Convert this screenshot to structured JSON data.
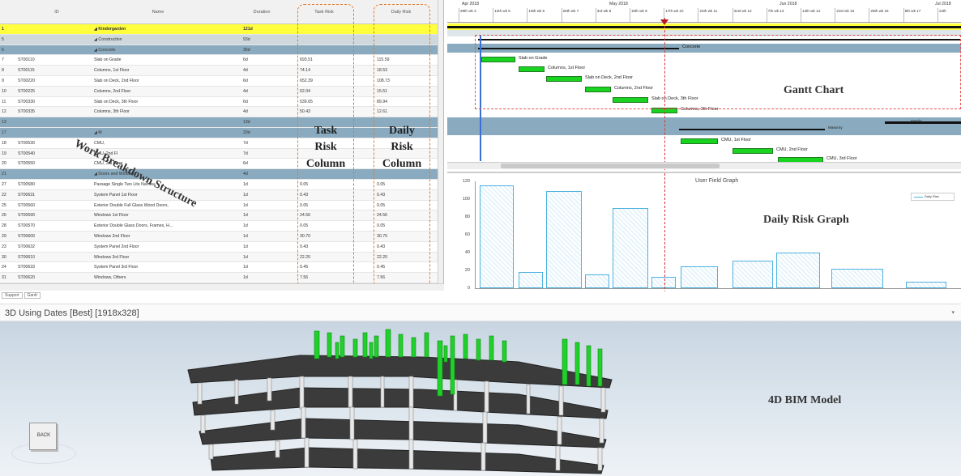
{
  "grid": {
    "headers": {
      "id": "ID",
      "name": "Name",
      "duration": "Duration",
      "task_risk": "Task Risk",
      "daily_risk": "Daily Risk"
    },
    "rows": [
      {
        "num": "1",
        "id": "",
        "name": "◢ Kindergarden",
        "duration": "121d",
        "task_risk": "",
        "daily_risk": "",
        "level": "lvl0"
      },
      {
        "num": "5",
        "id": "",
        "name": "◢ Construction",
        "duration": "93d",
        "task_risk": "",
        "daily_risk": "",
        "level": "lvl1"
      },
      {
        "num": "6",
        "id": "",
        "name": "◢ Concrete",
        "duration": "36d",
        "task_risk": "",
        "daily_risk": "",
        "level": "lvl2"
      },
      {
        "num": "7",
        "id": "ST00110",
        "name": "Slab on Grade",
        "duration": "6d",
        "task_risk": "693.51",
        "daily_risk": "115.59",
        "level": ""
      },
      {
        "num": "8",
        "id": "ST00115",
        "name": "Columns, 1st Floor",
        "duration": "4d",
        "task_risk": "74.14",
        "daily_risk": "18.53",
        "level": "alt"
      },
      {
        "num": "9",
        "id": "ST00220",
        "name": "Slab on Deck, 2nd Floor",
        "duration": "6d",
        "task_risk": "652.39",
        "daily_risk": "108.73",
        "level": ""
      },
      {
        "num": "10",
        "id": "ST00225",
        "name": "Columns, 2nd Floor",
        "duration": "4d",
        "task_risk": "62.04",
        "daily_risk": "15.51",
        "level": "alt"
      },
      {
        "num": "11",
        "id": "ST00330",
        "name": "Slab on Deck, 3th Floor",
        "duration": "6d",
        "task_risk": "539.65",
        "daily_risk": "89.94",
        "level": ""
      },
      {
        "num": "12",
        "id": "ST00335",
        "name": "Columns, 3th Floor",
        "duration": "4d",
        "task_risk": "50.43",
        "daily_risk": "12.61",
        "level": "alt"
      },
      {
        "num": "13",
        "id": "",
        "name": "",
        "duration": "13d",
        "task_risk": "",
        "daily_risk": "",
        "level": "lvl2"
      },
      {
        "num": "17",
        "id": "",
        "name": "◢ M",
        "duration": "20d",
        "task_risk": "",
        "daily_risk": "",
        "level": "lvl2"
      },
      {
        "num": "18",
        "id": "ST00530",
        "name": "CMU, ",
        "duration": "7d",
        "task_risk": "",
        "daily_risk": "",
        "level": ""
      },
      {
        "num": "19",
        "id": "ST00540",
        "name": "CMU, 2nd Fl",
        "duration": "7d",
        "task_risk": "",
        "daily_risk": "",
        "level": "alt"
      },
      {
        "num": "20",
        "id": "ST00550",
        "name": "CMU, 3rd Floor",
        "duration": "6d",
        "task_risk": "",
        "daily_risk": "",
        "level": ""
      },
      {
        "num": "21",
        "id": "",
        "name": "◢ Doors and Windows",
        "duration": "4d",
        "task_risk": "",
        "daily_risk": "",
        "level": "lvl2"
      },
      {
        "num": "27",
        "id": "ST00580",
        "name": "Passage Single Two Lite Narrow",
        "duration": "1d",
        "task_risk": "0.05",
        "daily_risk": "0.05",
        "level": ""
      },
      {
        "num": "22",
        "id": "ST00631",
        "name": "System Panel 1st Floor",
        "duration": "1d",
        "task_risk": "0.43",
        "daily_risk": "0.43",
        "level": "alt"
      },
      {
        "num": "25",
        "id": "ST00560",
        "name": "Exterior Double Full Glass Wood Doors,",
        "duration": "1d",
        "task_risk": "0.05",
        "daily_risk": "0.05",
        "level": ""
      },
      {
        "num": "26",
        "id": "ST00590",
        "name": "Windows 1st Floor",
        "duration": "1d",
        "task_risk": "24.56",
        "daily_risk": "24.56",
        "level": "alt"
      },
      {
        "num": "28",
        "id": "ST00570",
        "name": "Exterior Double Glass Doors, Frames, H...",
        "duration": "1d",
        "task_risk": "0.05",
        "daily_risk": "0.05",
        "level": ""
      },
      {
        "num": "29",
        "id": "ST00600",
        "name": "Windows 2nd Floor",
        "duration": "1d",
        "task_risk": "30.70",
        "daily_risk": "30.70",
        "level": "alt"
      },
      {
        "num": "23",
        "id": "ST00632",
        "name": "System Panel 2nd Floor",
        "duration": "1d",
        "task_risk": "0.43",
        "daily_risk": "0.43",
        "level": ""
      },
      {
        "num": "30",
        "id": "ST00610",
        "name": "Windows 3rd Floor",
        "duration": "1d",
        "task_risk": "22.20",
        "daily_risk": "22.20",
        "level": "alt"
      },
      {
        "num": "24",
        "id": "ST00633",
        "name": "System Panel 3rd Floor",
        "duration": "1d",
        "task_risk": "0.45",
        "daily_risk": "0.45",
        "level": ""
      },
      {
        "num": "31",
        "id": "ST00620",
        "name": "Windows, Others",
        "duration": "1d",
        "task_risk": "7.56",
        "daily_risk": "7.56",
        "level": "alt"
      }
    ],
    "tabs": [
      "Support",
      "Gantt"
    ]
  },
  "overlays": {
    "wbs": "Work Breakdown Structure",
    "task_risk_col": [
      "Task",
      "Risk",
      "Column"
    ],
    "daily_risk_col": [
      "Daily",
      "Risk",
      "Column"
    ],
    "gantt_label": "Gantt Chart",
    "daily_risk_graph": "Daily Risk Graph",
    "bim_label": "4D BIM Model"
  },
  "gantt": {
    "months": [
      "Apr 2018",
      "May 2018",
      "Jun 2018",
      "Jul 2018"
    ],
    "weeks": [
      "29th wk 4",
      "12th wk 5",
      "19th wk 6",
      "26th wk 7",
      "3rd wk 8",
      "10th wk 9",
      "17th wk 10",
      "24th wk 11",
      "31st wk 12",
      "7th wk 13",
      "14th wk 14",
      "21st wk 15",
      "28th wk 16",
      "5th wk 17",
      "12th"
    ],
    "task_labels": [
      "Slab on Grade",
      "Columns, 1st Floor",
      "Slab on Deck, 2nd Floor",
      "Columns, 2nd Floor",
      "Slab on Deck, 3th Floor",
      "Columns, 3th Floor",
      "CMU, 1st Floor",
      "CMU, 2nd Floor",
      "CMU, 3rd Floor"
    ],
    "summary_labels": [
      "Concrete",
      "Masonry",
      "Metals"
    ]
  },
  "risk_graph": {
    "title": "User Field Graph",
    "legend": "Daily Risk",
    "y_ticks": [
      "120",
      "100",
      "80",
      "60",
      "40",
      "20",
      "0"
    ]
  },
  "chart_data": {
    "type": "bar",
    "title": "User Field Graph",
    "ylim": [
      0,
      120
    ],
    "series": [
      {
        "name": "Daily Risk",
        "values": [
          115.59,
          18.53,
          108.73,
          15.51,
          89.94,
          12.61,
          24.56,
          30.7,
          40,
          22.2,
          7.56
        ]
      }
    ]
  },
  "bim": {
    "title": "3D Using Dates [Best] [1918x328]",
    "cube_label": "BACK",
    "chevron": "▾"
  },
  "colors": {
    "summary_bar": "#ffff3d",
    "task_bar": "#18d420",
    "risk_bar": "#4fb2e0",
    "annotation": "#e07a30"
  }
}
